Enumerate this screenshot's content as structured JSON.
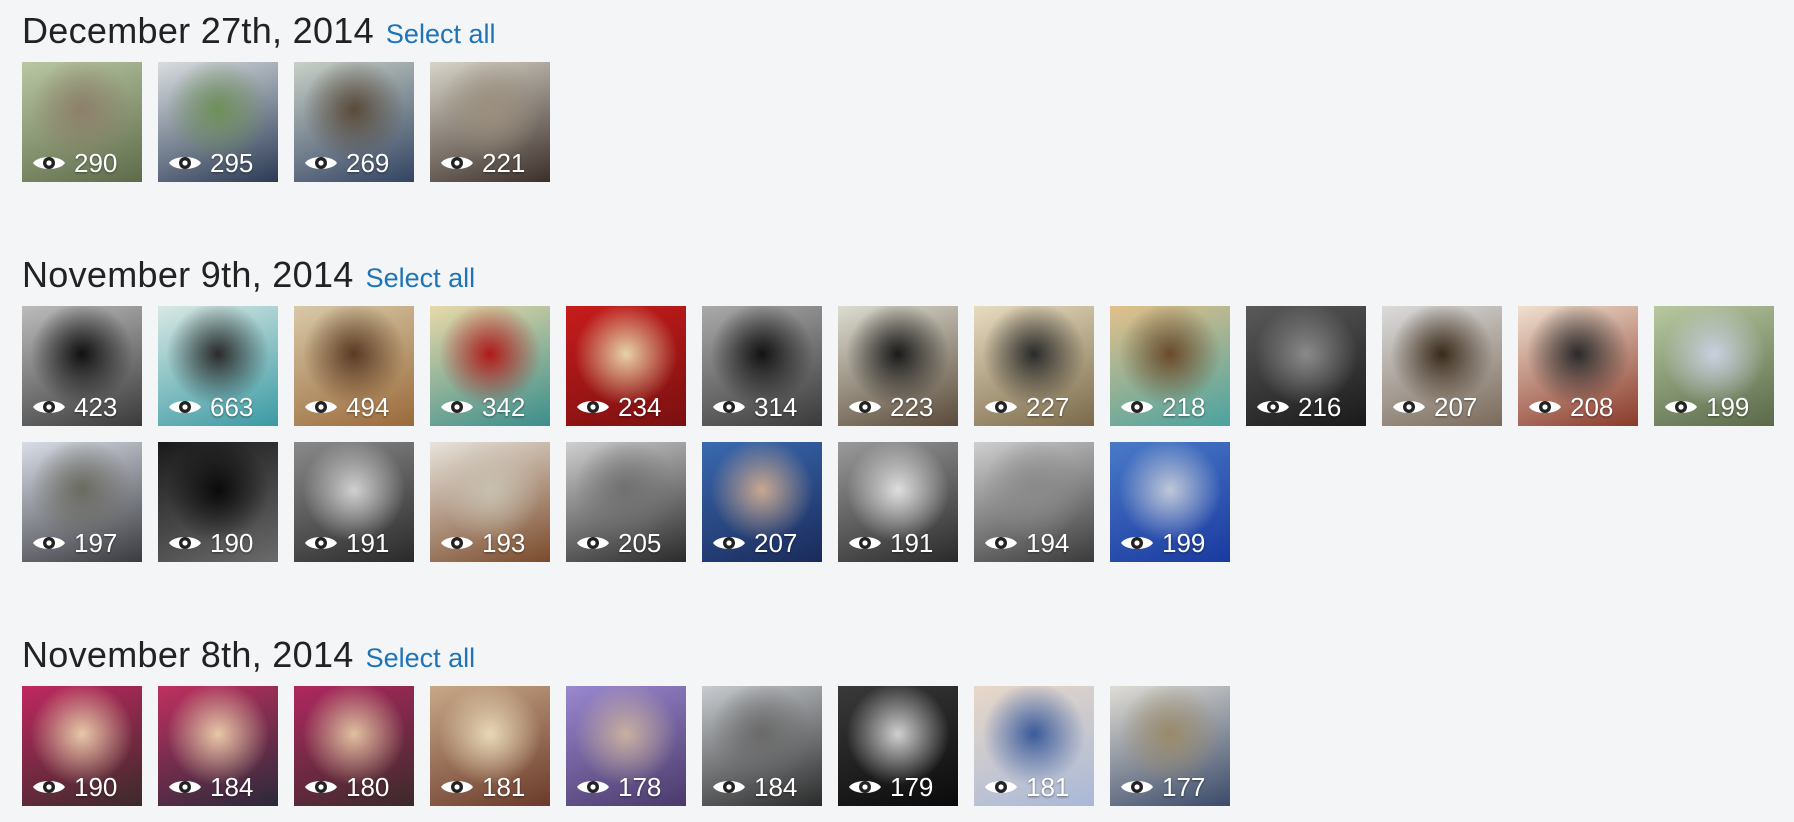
{
  "sections": [
    {
      "date": "December 27th, 2014",
      "select_all": "Select all",
      "photos": [
        {
          "views": "290",
          "colors": [
            "#b9c7a3",
            "#5e6b4a",
            "#8d7f6a"
          ]
        },
        {
          "views": "295",
          "colors": [
            "#d9dde0",
            "#2b3b55",
            "#6e8f59"
          ]
        },
        {
          "views": "269",
          "colors": [
            "#c8d0c6",
            "#334463",
            "#5a4a3a"
          ]
        },
        {
          "views": "221",
          "colors": [
            "#d8d4c8",
            "#3b2f2a",
            "#9b8f7d"
          ]
        }
      ]
    },
    {
      "date": "November 9th, 2014",
      "select_all": "Select all",
      "photos": [
        {
          "views": "423",
          "colors": [
            "#bcbcbc",
            "#3a3a3a",
            "#101010"
          ]
        },
        {
          "views": "663",
          "colors": [
            "#d8e8e4",
            "#3a9aa3",
            "#2a2a2a"
          ]
        },
        {
          "views": "494",
          "colors": [
            "#d8c9a8",
            "#9a6a3a",
            "#5a3a24"
          ]
        },
        {
          "views": "342",
          "colors": [
            "#e8d9a8",
            "#3a8e8c",
            "#b01a1a"
          ]
        },
        {
          "views": "234",
          "colors": [
            "#c81c1c",
            "#7a1010",
            "#e6d2a8"
          ]
        },
        {
          "views": "314",
          "colors": [
            "#aaaaaa",
            "#3a3a3a",
            "#121212"
          ]
        },
        {
          "views": "223",
          "colors": [
            "#dcdcd0",
            "#5a4a3a",
            "#1a1a1a"
          ]
        },
        {
          "views": "227",
          "colors": [
            "#e8dcc0",
            "#7a6a4a",
            "#2a2a2a"
          ]
        },
        {
          "views": "218",
          "colors": [
            "#e3c08a",
            "#4aa3a0",
            "#6a4a2a"
          ]
        },
        {
          "views": "216",
          "colors": [
            "#5a5a5a",
            "#1a1a1a",
            "#8a8a8a"
          ]
        },
        {
          "views": "207",
          "colors": [
            "#dcdcdc",
            "#7a6a5a",
            "#3a2a1a"
          ]
        },
        {
          "views": "208",
          "colors": [
            "#f0e0d0",
            "#8a3a2a",
            "#2a2a2a"
          ]
        },
        {
          "views": "199",
          "colors": [
            "#b8c8a0",
            "#5a6a4a",
            "#c8d0e0"
          ]
        },
        {
          "views": "197",
          "colors": [
            "#d8dde6",
            "#3a3a40",
            "#6a6a60"
          ]
        },
        {
          "views": "190",
          "colors": [
            "#1a1a1a",
            "#6a6a6a",
            "#0a0a0a"
          ]
        },
        {
          "views": "191",
          "colors": [
            "#8a8a8a",
            "#2a2a2a",
            "#d0d0d0"
          ]
        },
        {
          "views": "193",
          "colors": [
            "#e8e4dc",
            "#7a4a2a",
            "#c8c0b0"
          ]
        },
        {
          "views": "205",
          "colors": [
            "#cfcfcf",
            "#2a2a2a",
            "#707070"
          ]
        },
        {
          "views": "207",
          "colors": [
            "#3a6ab0",
            "#1a2a5a",
            "#c8a890"
          ]
        },
        {
          "views": "191",
          "colors": [
            "#9a9a9a",
            "#2a2a2a",
            "#dedede"
          ]
        },
        {
          "views": "194",
          "colors": [
            "#cfcfcf",
            "#3a3a3a",
            "#8a8a8a"
          ]
        },
        {
          "views": "199",
          "colors": [
            "#4a7ac8",
            "#1a3aa0",
            "#c0c8d8"
          ]
        }
      ]
    },
    {
      "date": "November 8th, 2014",
      "select_all": "Select all",
      "photos": [
        {
          "views": "190",
          "colors": [
            "#c02860",
            "#3a2a2a",
            "#e8c8a8"
          ]
        },
        {
          "views": "184",
          "colors": [
            "#c03060",
            "#2a2a3a",
            "#e8c8a8"
          ]
        },
        {
          "views": "180",
          "colors": [
            "#b02860",
            "#3a2a2a",
            "#e0c0a0"
          ]
        },
        {
          "views": "181",
          "colors": [
            "#c8a888",
            "#6a3a2a",
            "#e8d8b8"
          ]
        },
        {
          "views": "178",
          "colors": [
            "#9a88d0",
            "#4a3a6a",
            "#c8b0a0"
          ]
        },
        {
          "views": "184",
          "colors": [
            "#c8ccd0",
            "#2a2a2a",
            "#6a6a6a"
          ]
        },
        {
          "views": "179",
          "colors": [
            "#3a3a3a",
            "#0a0a0a",
            "#d0d0d0"
          ]
        },
        {
          "views": "181",
          "colors": [
            "#e8d8c8",
            "#a8b8d8",
            "#3a5a9a"
          ]
        },
        {
          "views": "177",
          "colors": [
            "#e0ddd5",
            "#3a4a6a",
            "#9a8a6a"
          ]
        }
      ]
    }
  ]
}
